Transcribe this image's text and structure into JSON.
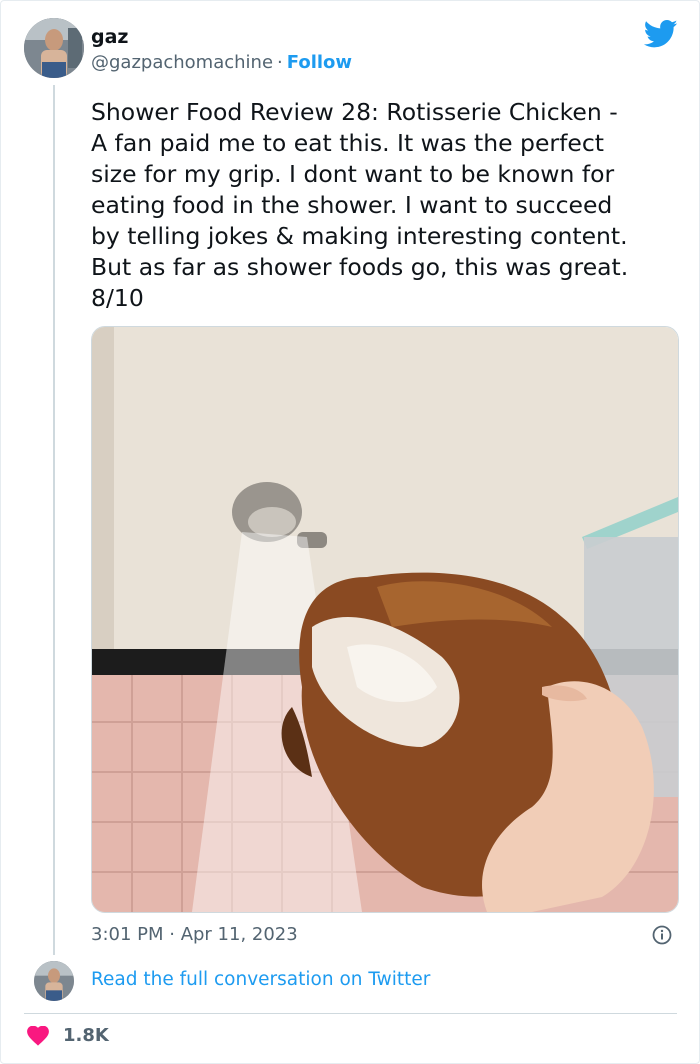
{
  "tweet": {
    "author": {
      "name": "gaz",
      "handle": "@gazpachomachine",
      "separator": "·",
      "follow_label": "Follow"
    },
    "text": "Shower Food Review 28: Rotisserie Chicken -\nA fan paid me to eat this. It was the perfect\nsize for my grip. I dont want to be known for\neating food in the shower. I want to succeed\nby telling jokes & making interesting content.\nBut as far as shower foods go, this was great.\n8/10",
    "timestamp": "3:01 PM · Apr 11, 2023",
    "read_more_label": "Read the full conversation on Twitter",
    "likes": "1.8K"
  },
  "icons": {
    "brand": "twitter-bird-icon",
    "info": "info-icon",
    "like": "heart-icon"
  },
  "colors": {
    "accent": "#1d9bf0",
    "like": "#f91880",
    "secondary_text": "#536471"
  }
}
